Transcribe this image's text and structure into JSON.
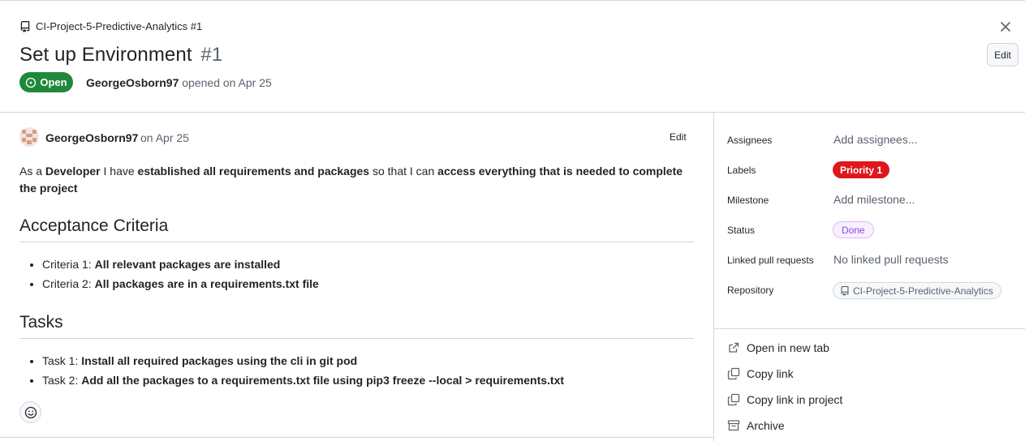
{
  "header": {
    "repo_name": "CI-Project-5-Predictive-Analytics #1",
    "title": "Set up Environment",
    "issue_number": "#1",
    "edit_label": "Edit",
    "status_badge": "Open",
    "author": "GeorgeOsborn97",
    "opened_text": "opened on Apr 25"
  },
  "comment": {
    "author": "GeorgeOsborn97",
    "date": "on Apr 25",
    "edit_label": "Edit",
    "intro": {
      "p1": "As a ",
      "b1": "Developer",
      "p2": " I have ",
      "b2": "established all requirements and packages",
      "p3": " so that I can ",
      "b3": "access everything that is needed to complete the project"
    },
    "acceptance_heading": "Acceptance Criteria",
    "criteria": [
      {
        "prefix": "Criteria 1: ",
        "text": "All relevant packages are installed"
      },
      {
        "prefix": "Criteria 2: ",
        "text": "All packages are in a requirements.txt file"
      }
    ],
    "tasks_heading": "Tasks",
    "tasks": [
      {
        "prefix": "Task 1: ",
        "text": "Install all required packages using the cli in git pod"
      },
      {
        "prefix": "Task 2: ",
        "text": "Add all the packages to a requirements.txt file using pip3 freeze --local > requirements.txt"
      }
    ]
  },
  "sidebar": {
    "assignees_label": "Assignees",
    "assignees_value": "Add assignees...",
    "labels_label": "Labels",
    "labels_value": "Priority 1",
    "milestone_label": "Milestone",
    "milestone_value": "Add milestone...",
    "status_label": "Status",
    "status_value": "Done",
    "linked_label": "Linked pull requests",
    "linked_value": "No linked pull requests",
    "repository_label": "Repository",
    "repository_value": "CI-Project-5-Predictive-Analytics",
    "actions": {
      "open_new_tab": "Open in new tab",
      "copy_link": "Copy link",
      "copy_link_project": "Copy link in project",
      "archive": "Archive"
    }
  },
  "colors": {
    "open_green": "#1f883d",
    "priority_red": "#e0161d",
    "done_purple": "#8250df"
  },
  "icons": [
    "repo-icon",
    "close-icon",
    "issue-open-icon",
    "smiley-icon",
    "link-external-icon",
    "copy-icon",
    "archive-icon"
  ]
}
